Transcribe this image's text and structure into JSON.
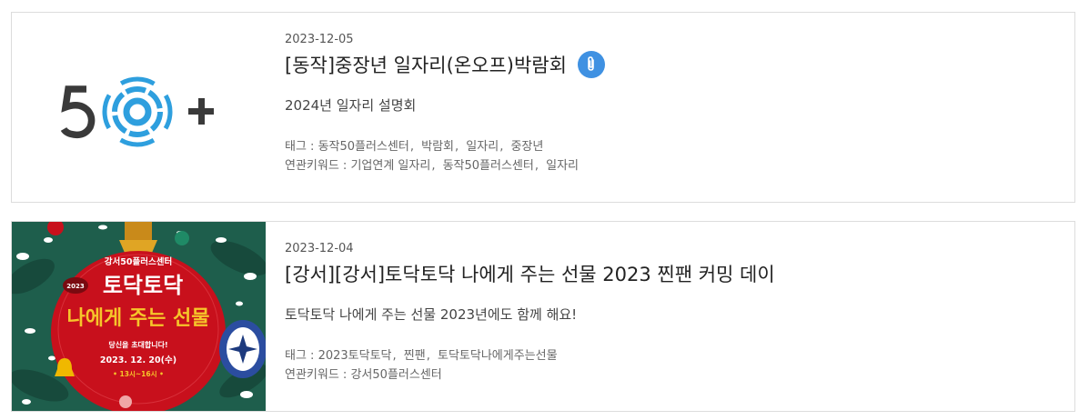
{
  "items": [
    {
      "thumb_logo": "50+",
      "date": "2023-12-05",
      "title": "[동작]중장년 일자리(온오프)박람회",
      "has_attachment": true,
      "desc": "2024년 일자리 설명회",
      "tags_label": "태그 :",
      "tags": [
        "동작50플러스센터",
        "박람회",
        "일자리",
        "중장년"
      ],
      "keywords_label": "연관키워드 :",
      "keywords": [
        "기업연계 일자리",
        "동작50플러스센터",
        "일자리"
      ]
    },
    {
      "poster": {
        "center": "강서50플러스센터",
        "badge": "2023",
        "line1": "토닥토닥",
        "line2": "나에게 주는 선물",
        "invite": "당신을 초대합니다!",
        "date": "2023. 12. 20(수)",
        "time": "• 13시~16시 •"
      },
      "date": "2023-12-04",
      "title": "[강서][강서]토닥토닥 나에게 주는 선물 2023 찐팬 커밍 데이",
      "has_attachment": false,
      "desc": "토닥토닥 나에게 주는 선물 2023년에도 함께 해요!",
      "tags_label": "태그 :",
      "tags": [
        "2023토닥토닥",
        "찐팬",
        "토닥토닥나에게주는선물"
      ],
      "keywords_label": "연관키워드 :",
      "keywords": [
        "강서50플러스센터"
      ]
    }
  ],
  "colors": {
    "logo_blue": "#2e9fde",
    "logo_dark": "#3a3a3a",
    "poster_red": "#c8101c",
    "poster_green": "#1e5e4c",
    "clip_blue": "#3f91e2"
  }
}
